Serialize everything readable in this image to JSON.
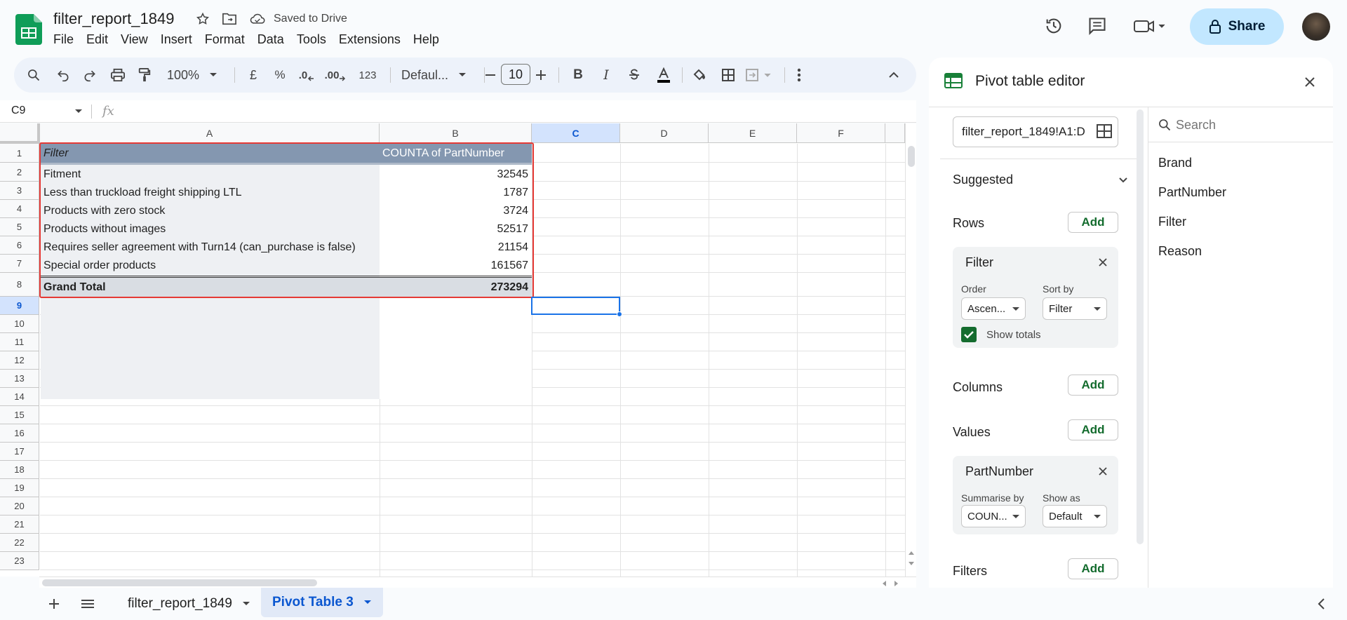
{
  "doc": {
    "title": "filter_report_1849",
    "saved_status": "Saved to Drive"
  },
  "menu": [
    "File",
    "Edit",
    "View",
    "Insert",
    "Format",
    "Data",
    "Tools",
    "Extensions",
    "Help"
  ],
  "share_label": "Share",
  "toolbar": {
    "zoom": "100%",
    "currency": "£",
    "percent": "%",
    "dec_decrease": ".0",
    "dec_increase": ".00",
    "number_format": "123",
    "font": "Defaul...",
    "font_size": "10"
  },
  "formula_bar": {
    "cell_ref": "C9",
    "fx": "fx",
    "value": ""
  },
  "grid": {
    "columns": [
      "A",
      "B",
      "C",
      "D",
      "E",
      "F"
    ],
    "rows": [
      "1",
      "2",
      "3",
      "4",
      "5",
      "6",
      "7",
      "8",
      "9",
      "10",
      "11",
      "12",
      "13",
      "14",
      "15",
      "16",
      "17",
      "18",
      "19",
      "20",
      "21",
      "22",
      "23"
    ],
    "pivot_header": {
      "a": "Filter",
      "b": "COUNTA of PartNumber"
    },
    "pivot_rows": [
      {
        "a": "Fitment",
        "b": "32545"
      },
      {
        "a": "Less than truckload freight shipping LTL",
        "b": "1787"
      },
      {
        "a": "Products with zero stock",
        "b": "3724"
      },
      {
        "a": "Products without images",
        "b": "52517"
      },
      {
        "a": "Requires seller agreement with Turn14 (can_purchase is false)",
        "b": "21154"
      },
      {
        "a": "Special order products",
        "b": "161567"
      }
    ],
    "grand_total": {
      "a": "Grand Total",
      "b": "273294"
    },
    "selected_cell": "C9"
  },
  "sheets": {
    "tabs": [
      {
        "label": "filter_report_1849",
        "active": false
      },
      {
        "label": "Pivot Table 3",
        "active": true
      }
    ]
  },
  "pivot_editor": {
    "title": "Pivot table editor",
    "range": "filter_report_1849!A1:D",
    "suggested": "Suggested",
    "rows_label": "Rows",
    "columns_label": "Columns",
    "values_label": "Values",
    "filters_label": "Filters",
    "add_label": "Add",
    "rows_card": {
      "title": "Filter",
      "order_label": "Order",
      "order_value": "Ascen...",
      "sortby_label": "Sort by",
      "sortby_value": "Filter",
      "show_totals": "Show totals",
      "show_totals_checked": true
    },
    "values_card": {
      "title": "PartNumber",
      "summarise_label": "Summarise by",
      "summarise_value": "COUN...",
      "showas_label": "Show as",
      "showas_value": "Default"
    },
    "search_placeholder": "Search",
    "fields": [
      "Brand",
      "PartNumber",
      "Filter",
      "Reason"
    ]
  },
  "colors": {
    "pivot_header_bg": "#8497b0",
    "pivot_body_a": "#eef0f3",
    "selection_blue": "#1a73e8",
    "accent_green": "#146c2e",
    "share_bg": "#c2e7ff",
    "outline_red": "#e53935"
  }
}
